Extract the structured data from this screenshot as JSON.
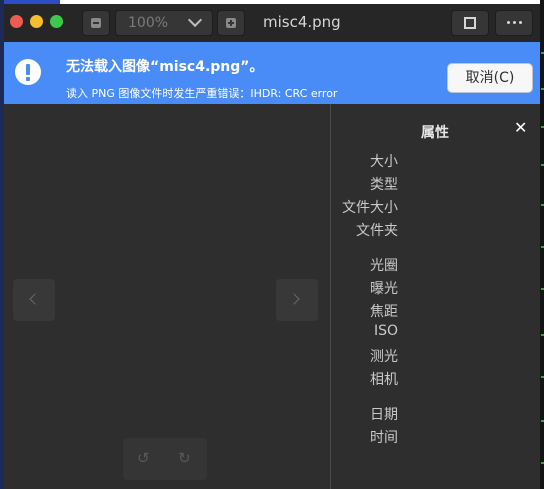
{
  "window": {
    "title": "misc4.png",
    "zoom_value": "100%"
  },
  "infobar": {
    "heading": "无法载入图像“misc4.png”。",
    "detail": "读入 PNG 图像文件时发生严重错误：IHDR: CRC error",
    "cancel_label": "取消(C)"
  },
  "viewer": {
    "rotate_left_glyph": "↺",
    "rotate_right_glyph": "↻"
  },
  "properties": {
    "title": "属性",
    "close_glyph": "✕",
    "labels": [
      "大小",
      "类型",
      "文件大小",
      "文件夹",
      "光圈",
      "曝光",
      "焦距",
      "ISO",
      "测光",
      "相机",
      "日期",
      "时间"
    ]
  },
  "colors": {
    "infobar": "#4a8cf7",
    "window_bg": "#2e2e2e",
    "header_bg": "#262626",
    "close": "#ed5b52",
    "minimize": "#f5be2f",
    "maximize": "#3fc94c"
  },
  "icons": [
    "zoom-out-icon",
    "chevron-down-icon",
    "zoom-in-icon",
    "fullscreen-icon",
    "more-icon",
    "info-icon",
    "chevron-left-icon",
    "chevron-right-icon",
    "rotate-left-icon",
    "rotate-right-icon",
    "close-icon"
  ]
}
